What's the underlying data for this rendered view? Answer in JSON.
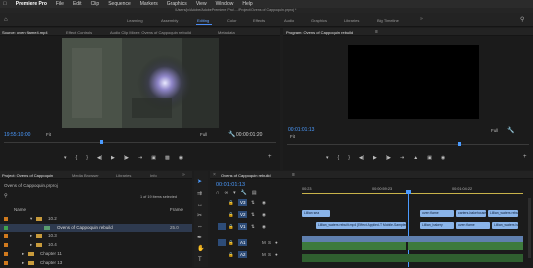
{
  "menubar": {
    "apple": "",
    "app_name": "Premiere Pro",
    "items": [
      "File",
      "Edit",
      "Clip",
      "Sequence",
      "Markers",
      "Graphics",
      "View",
      "Window",
      "Help"
    ]
  },
  "titlebar": {
    "path": "/Users/jx/Adobe/AdobePremiere Pro/..../Project/Ovens of Cappoquin.prproj *"
  },
  "workspaces": {
    "items": [
      "Learning",
      "Assembly",
      "Editing",
      "Color",
      "Effects",
      "Audio",
      "Graphics",
      "Libraries",
      "Big Timeline"
    ],
    "active": "Editing"
  },
  "source": {
    "tabs": [
      "Source: oven flame4.mp4",
      "Effect Controls",
      "Audio Clip Mixer: Ovens of Cappoquin rebuild",
      "Metadata"
    ],
    "timecode": "19:55:10:00",
    "fit": "Fit",
    "duration": "00:00:01:20",
    "full": "Full"
  },
  "program": {
    "tab": "Program: Ovens of Cappoquin rebuild",
    "timecode": "00:01:01:13",
    "fit": "Fit",
    "full": "Full",
    "duration": "00:05:01:13"
  },
  "project": {
    "tabs": [
      "Project: Ovens of Cappoquin",
      "Media Browser",
      "Libraries",
      "Info"
    ],
    "file": "Ovens of Cappoquin.prproj",
    "selection": "1 of 19 items selected",
    "col_name": "Name",
    "col_rate": "Frame",
    "rows": [
      {
        "label": "10.2"
      },
      {
        "label": "Ovens of Cappoquin rebuild",
        "rate": "25.0"
      },
      {
        "label": "10.3"
      },
      {
        "label": "10.4"
      },
      {
        "label": "Chapter 11"
      },
      {
        "label": "Chapter 13"
      }
    ]
  },
  "timeline": {
    "tab": "Ovens of Cappoquin rebuild",
    "timecode": "00:01:01:13",
    "ruler": [
      "00:23",
      "00:00:59:23",
      "00:01:04:22"
    ],
    "video_tracks": [
      "V3",
      "V2",
      "V1"
    ],
    "audio_tracks": [
      "A1",
      "A2"
    ],
    "clips": [
      {
        "label": "Lillian sea"
      },
      {
        "label": "Lillian_waters rebuilt.mp4 [Effect Applied-T Mobile-Sampled]"
      },
      {
        "label": "oven flame"
      },
      {
        "label": "carters-bakehouse"
      },
      {
        "label": "Lillian_waters rebuilt [V]"
      },
      {
        "label": "Lillian_bakery"
      },
      {
        "label": "oven flame"
      },
      {
        "label": "Lillian_waters bakehouse_01"
      }
    ]
  },
  "colors": {
    "accent": "#4b9bff",
    "clip_blue": "#8ab4e8",
    "clip_audio": "#3d7a3d",
    "playhead": "#4b9bff"
  }
}
